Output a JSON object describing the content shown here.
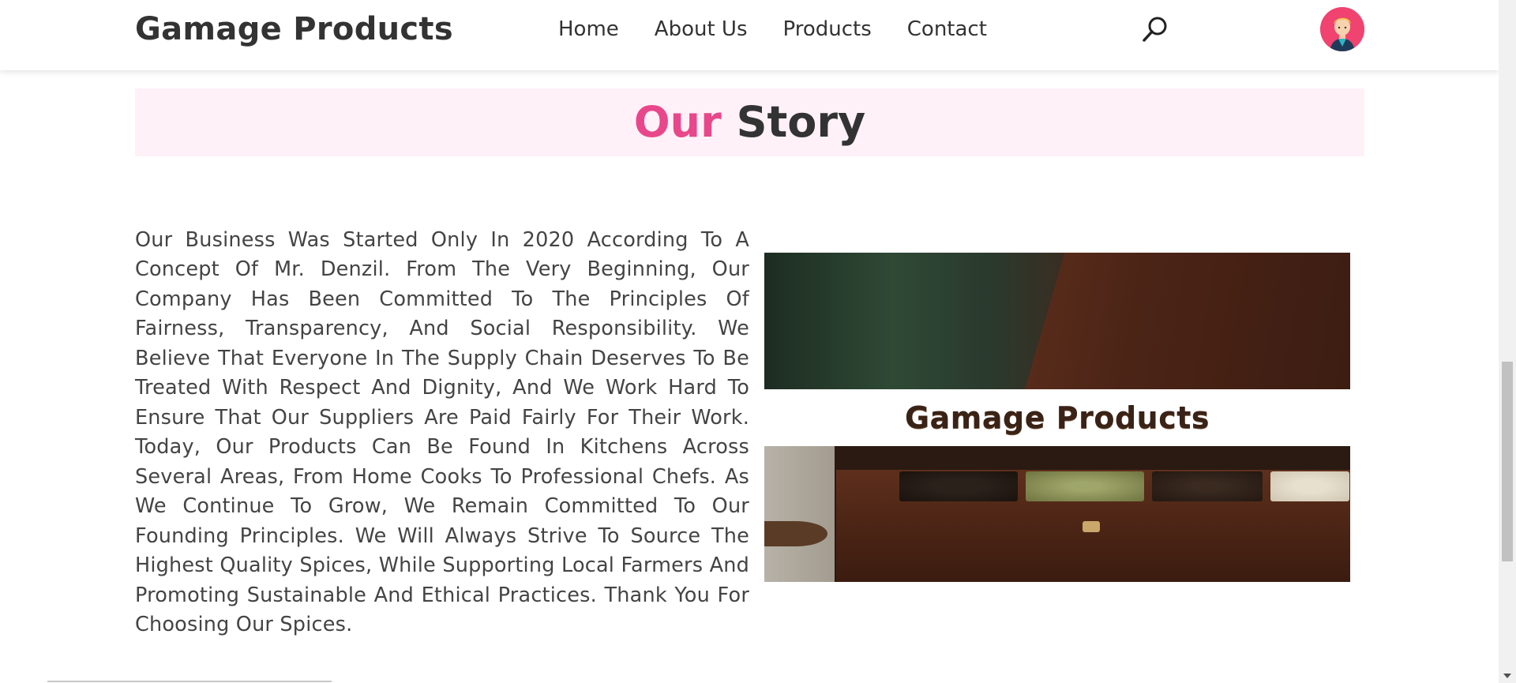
{
  "header": {
    "brand": "Gamage Products",
    "nav": [
      "Home",
      "About Us",
      "Products",
      "Contact"
    ]
  },
  "story": {
    "title_accent": "Our",
    "title_rest": "Story",
    "paragraph": "Our Business Was Started Only In 2020 According To A Concept Of Mr. Denzil. From The Very Beginning, Our Company Has Been Committed To The Principles Of Fairness, Transparency, And Social Responsibility. We Believe That Everyone In The Supply Chain Deserves To Be Treated With Respect And Dignity, And We Work Hard To Ensure That Our Suppliers Are Paid Fairly For Their Work. Today, Our Products Can Be Found In Kitchens Across Several Areas, From Home Cooks To Professional Chefs. As We Continue To Grow, We Remain Committed To Our Founding Principles. We Will Always Strive To Source The Highest Quality Spices, While Supporting Local Farmers And Promoting Sustainable And Ethical Practices. Thank You For Choosing Our Spices.",
    "image_caption": "Gamage Products"
  },
  "colors": {
    "accent": "#e8478b",
    "band_bg": "#fff1f7",
    "text": "#333333"
  },
  "icons": {
    "search": "search-icon",
    "avatar": "avatar"
  }
}
